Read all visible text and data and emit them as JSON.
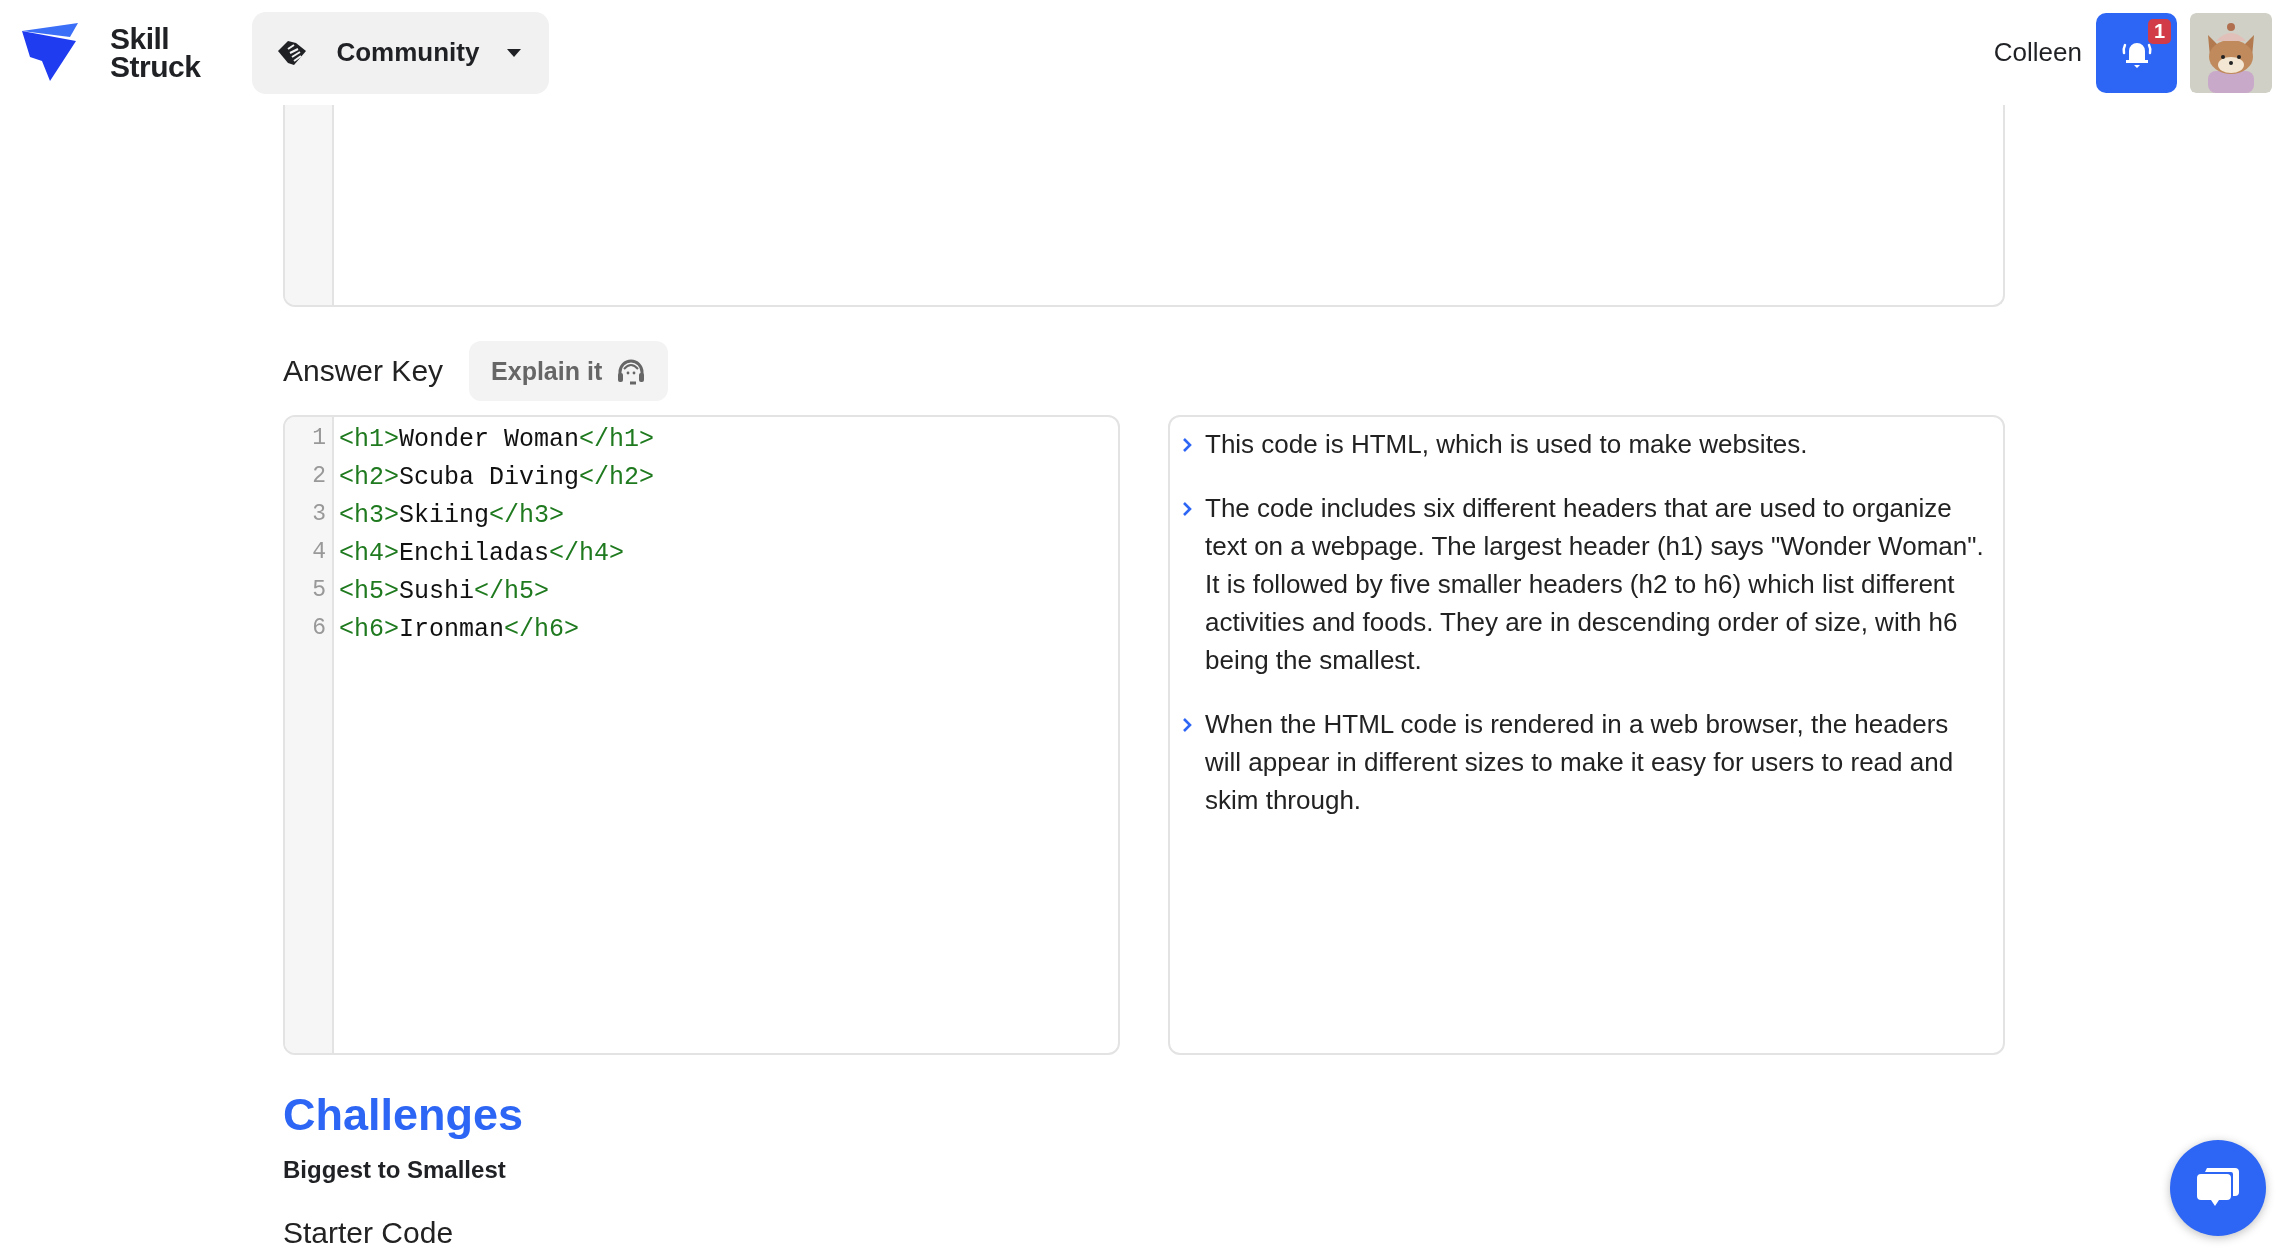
{
  "header": {
    "logo_text": [
      "Skill",
      "Struck"
    ],
    "community_menu": {
      "label": "Community"
    },
    "user_name": "Colleen",
    "notifications": {
      "count": "1"
    }
  },
  "answer_key": {
    "title": "Answer Key",
    "explain_button": "Explain it",
    "code_lines": [
      {
        "number": "1",
        "open_tag": "<h1>",
        "content": "Wonder Woman",
        "close_tag": "</h1>"
      },
      {
        "number": "2",
        "open_tag": "<h2>",
        "content": "Scuba Diving",
        "close_tag": "</h2>"
      },
      {
        "number": "3",
        "open_tag": "<h3>",
        "content": "Skiing",
        "close_tag": "</h3>"
      },
      {
        "number": "4",
        "open_tag": "<h4>",
        "content": "Enchiladas",
        "close_tag": "</h4>"
      },
      {
        "number": "5",
        "open_tag": "<h5>",
        "content": "Sushi",
        "close_tag": "</h5>"
      },
      {
        "number": "6",
        "open_tag": "<h6>",
        "content": "Ironman",
        "close_tag": "</h6>"
      }
    ],
    "explanation": [
      "This code is HTML, which is used to make websites.",
      "The code includes six different headers that are used to organize text on a webpage. The largest header (h1) says \"Wonder Woman\". It is followed by five smaller headers (h2 to h6) which list different activities and foods. They are in descending order of size, with h6 being the smallest.",
      "When the HTML code is rendered in a web browser, the headers will appear in different sizes to make it easy for users to read and skim through."
    ]
  },
  "challenges": {
    "title": "Challenges",
    "challenge_name": "Biggest to Smallest",
    "starter_code_label": "Starter Code"
  }
}
